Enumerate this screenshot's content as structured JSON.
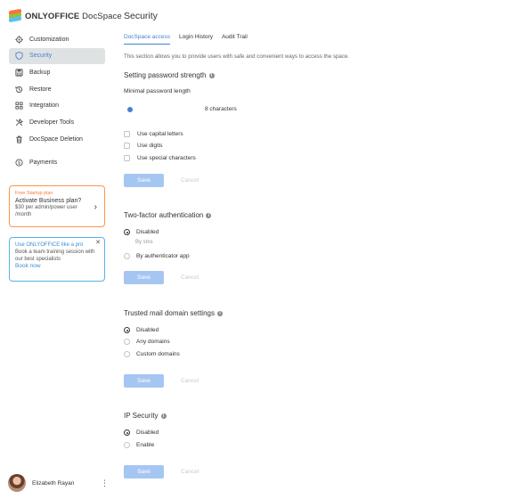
{
  "app": {
    "brand_bold": "ONLYOFFICE",
    "brand_light": " DocSpace"
  },
  "sidebar": {
    "items": [
      {
        "label": "Customization",
        "icon": "gear-icon"
      },
      {
        "label": "Security",
        "icon": "shield-icon",
        "active": true
      },
      {
        "label": "Backup",
        "icon": "floppy-icon"
      },
      {
        "label": "Restore",
        "icon": "restore-icon"
      },
      {
        "label": "Integration",
        "icon": "grid-icon"
      },
      {
        "label": "Developer Tools",
        "icon": "tools-icon"
      },
      {
        "label": "DocSpace Deletion",
        "icon": "trash-icon"
      }
    ],
    "payments_label": "Payments"
  },
  "promo_startup": {
    "head": "Free Startup plan",
    "title": "Activate Business plan?",
    "sub": "$30 per admin/power user /month"
  },
  "promo_pro": {
    "head": "Use ONLYOFFICE like a pro",
    "sub": "Book a team training session with our best specialists",
    "link": "Book now"
  },
  "user": {
    "name": "Elizabeth Rayan"
  },
  "main": {
    "title": "Security",
    "tabs": [
      "DocSpace access",
      "Login History",
      "Audit Trail"
    ],
    "intro": "This section allows you to provide users with safe and convenient ways to access the space."
  },
  "password": {
    "title": "Setting password strength",
    "min_length_label": "Minimal password length",
    "slider_fraction": 0.0,
    "value_text": "8 characters",
    "options": [
      "Use capital letters",
      "Use digits",
      "Use special characters"
    ],
    "save": "Save",
    "cancel": "Cancel"
  },
  "tfa": {
    "title": "Two-factor authentication",
    "options": [
      "Disabled",
      "By authenticator app"
    ],
    "sub_option": "By sms",
    "save": "Save",
    "cancel": "Cancel"
  },
  "domain": {
    "title": "Trusted mail domain settings",
    "options": [
      "Disabled",
      "Any domains",
      "Custom domains"
    ],
    "save": "Save",
    "cancel": "Cancel"
  },
  "ip": {
    "title": "IP Security",
    "options": [
      "Disabled",
      "Enable"
    ],
    "save": "Save",
    "cancel": "Cancel"
  },
  "colors": {
    "accent": "#4781d1",
    "save_disabled": "#a6c6f2",
    "promo_orange": "#ff9350",
    "promo_blue": "#5bb1e1",
    "active_nav_bg": "#dfe2e3"
  }
}
